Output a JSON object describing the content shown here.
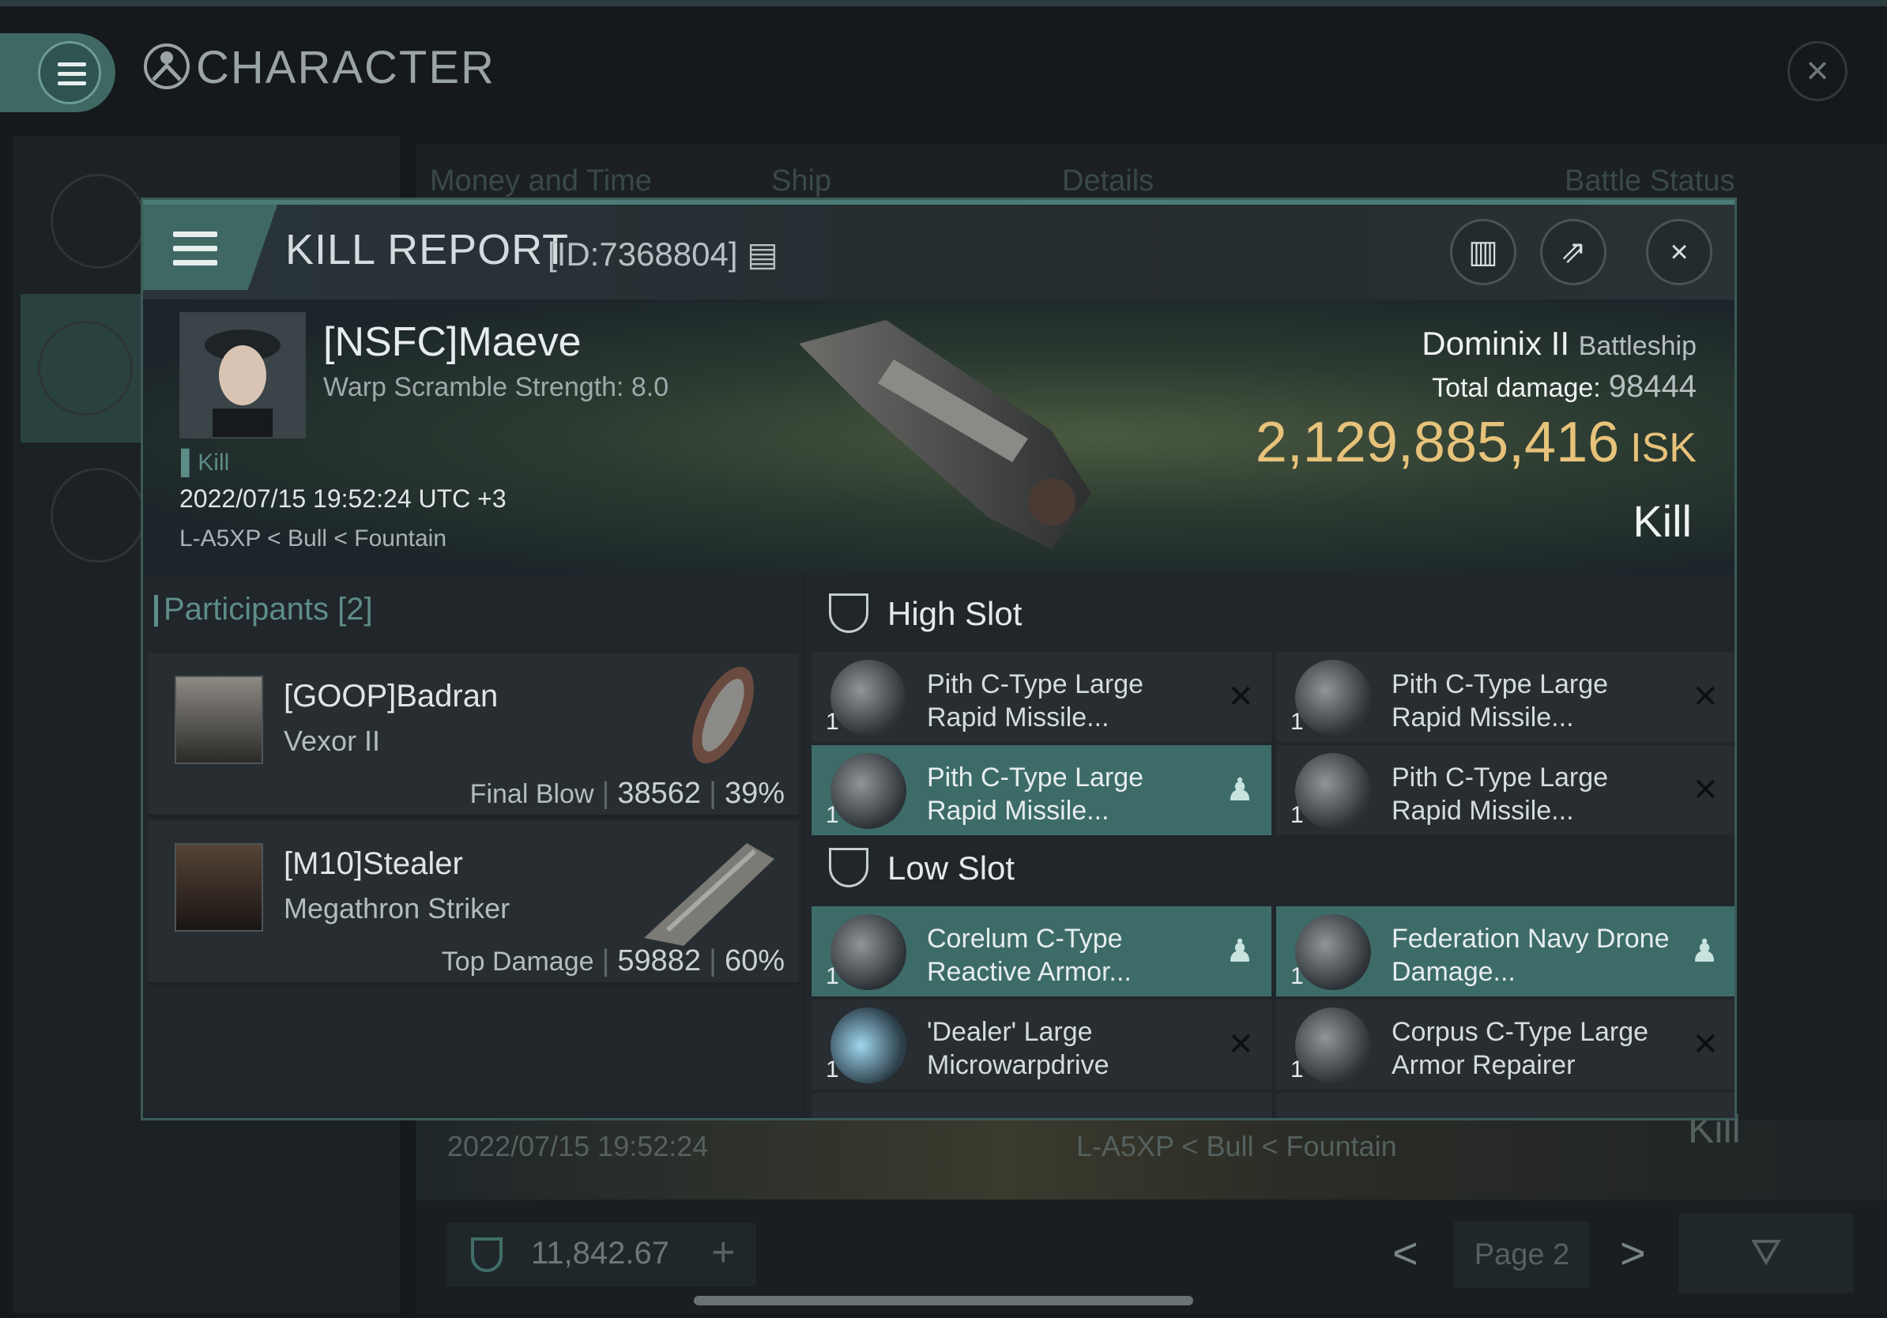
{
  "app": {
    "title": "CHARACTER",
    "close_icon": "close-icon",
    "menu_icon": "hamburger-icon"
  },
  "background": {
    "tabs": [
      "Money and Time",
      "Ship",
      "Details",
      "Battle Status"
    ],
    "row_date": "2022/07/15 19:52:24",
    "row_location": "L-A5XP < Bull < Fountain",
    "row_result": "Kill",
    "wallet": "11,842.67",
    "wallet_add": "+",
    "page_label": "Page 2",
    "prev": "<",
    "next": ">"
  },
  "kill_report": {
    "title": "KILL REPORT",
    "id": "[ID:7368804]",
    "victim": {
      "name": "[NSFC]Maeve",
      "warp": "Warp Scramble Strength: 8.0",
      "tag": "Kill",
      "datetime": "2022/07/15 19:52:24 UTC +3",
      "location": "L-A5XP < Bull < Fountain",
      "ship": "Dominix II",
      "ship_class": "Battleship",
      "damage_label": "Total damage:",
      "damage": "98444",
      "value": "2,129,885,416",
      "value_unit": "ISK",
      "result": "Kill"
    },
    "participants": {
      "header": "Participants [2]",
      "rows": [
        {
          "name": "[GOOP]Badran",
          "ship": "Vexor II",
          "label": "Final Blow",
          "damage": "38562",
          "percent": "39%"
        },
        {
          "name": "[M10]Stealer",
          "ship": "Megathron Striker",
          "label": "Top Damage",
          "damage": "59882",
          "percent": "60%"
        }
      ]
    },
    "high_slot": {
      "label": "High Slot",
      "items": [
        {
          "qty": "1",
          "name": "Pith C-Type Large Rapid Missile...",
          "status": "destroyed"
        },
        {
          "qty": "1",
          "name": "Pith C-Type Large Rapid Missile...",
          "status": "destroyed"
        },
        {
          "qty": "1",
          "name": "Pith C-Type Large Rapid Missile...",
          "status": "dropped"
        },
        {
          "qty": "1",
          "name": "Pith C-Type Large Rapid Missile...",
          "status": "destroyed"
        }
      ]
    },
    "low_slot": {
      "label": "Low Slot",
      "items": [
        {
          "qty": "1",
          "name": "Corelum C-Type Reactive Armor...",
          "status": "dropped"
        },
        {
          "qty": "1",
          "name": "Federation Navy Drone Damage...",
          "status": "dropped"
        },
        {
          "qty": "1",
          "name": "'Dealer' Large Microwarpdrive",
          "status": "destroyed"
        },
        {
          "qty": "1",
          "name": "Corpus C-Type Large Armor Repairer",
          "status": "destroyed"
        }
      ]
    },
    "colors": {
      "accent": "#3f6863",
      "isk": "#e7c27a",
      "dropped": "#3d6c68"
    }
  }
}
